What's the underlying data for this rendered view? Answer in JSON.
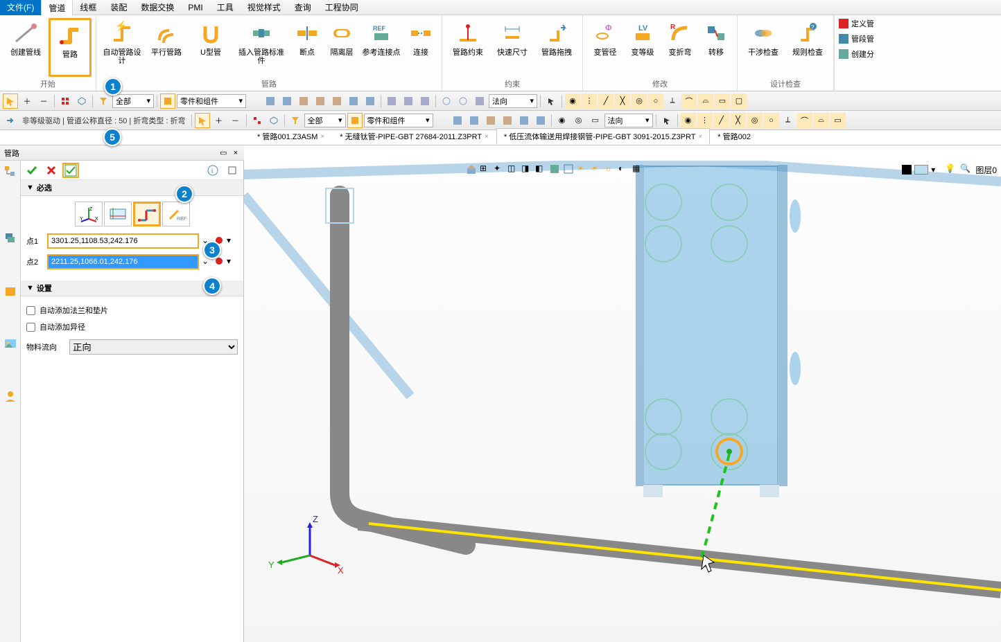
{
  "menu": {
    "file": "文件(F)",
    "items": [
      "管道",
      "线框",
      "装配",
      "数据交换",
      "PMI",
      "工具",
      "视觉样式",
      "查询",
      "工程协同"
    ]
  },
  "ribbon": {
    "groups": {
      "start": {
        "title": "开始",
        "buttons": [
          {
            "id": "create-line",
            "label": "创建管线"
          },
          {
            "id": "route",
            "label": "管路"
          }
        ]
      },
      "route": {
        "title": "管路",
        "buttons": [
          {
            "id": "auto-route",
            "label": "自动管路设计"
          },
          {
            "id": "parallel-route",
            "label": "平行管路"
          },
          {
            "id": "u-pipe",
            "label": "U型管"
          },
          {
            "id": "insert-std",
            "label": "插入管路标准件"
          },
          {
            "id": "breakpoint",
            "label": "断点"
          },
          {
            "id": "isolation",
            "label": "隔离层"
          },
          {
            "id": "ref-connect",
            "label": "参考连接点"
          },
          {
            "id": "connect",
            "label": "连接"
          }
        ]
      },
      "constraint": {
        "title": "约束",
        "buttons": [
          {
            "id": "route-constraint",
            "label": "管路约束"
          },
          {
            "id": "quick-dim",
            "label": "快速尺寸"
          },
          {
            "id": "route-drag",
            "label": "管路拖拽"
          }
        ]
      },
      "modify": {
        "title": "修改",
        "buttons": [
          {
            "id": "change-dia",
            "label": "变管径"
          },
          {
            "id": "change-grade",
            "label": "变等级"
          },
          {
            "id": "change-bend",
            "label": "变折弯"
          },
          {
            "id": "transfer",
            "label": "转移"
          }
        ]
      },
      "design_check": {
        "title": "设计检查",
        "buttons": [
          {
            "id": "interference",
            "label": "干涉检查"
          },
          {
            "id": "rule-check",
            "label": "规则检查"
          }
        ]
      }
    },
    "side_items": [
      "定义管",
      "管段管",
      "创建分"
    ]
  },
  "filterbar1": {
    "combo1": "全部",
    "combo2": "零件和组件",
    "normal": "法向"
  },
  "filterbar2": {
    "status": "非等级驱动 | 管道公称直径 : 50 | 折弯类型 : 折弯",
    "combo1": "全部",
    "combo2": "零件和组件",
    "normal": "法向"
  },
  "tabs": [
    {
      "label": "* 管路001.Z3ASM",
      "active": false
    },
    {
      "label": "* 无缝钛管-PIPE-GBT 27684-2011.Z3PRT",
      "active": false
    },
    {
      "label": "* 低压流体输送用焊接钢管-PIPE-GBT 3091-2015.Z3PRT",
      "active": true
    },
    {
      "label": "* 管路002",
      "active": false
    }
  ],
  "panel": {
    "title": "管路",
    "required_header": "必选",
    "settings_header": "设置",
    "point1_label": "点1",
    "point1_value": "3301.25,1108.53,242.176",
    "point2_label": "点2",
    "point2_value": "2211.25,1066.01,242.176",
    "check_flange": "自动添加法兰和垫片",
    "check_reducer": "自动添加异径",
    "flow_dir_label": "物料流向",
    "flow_dir_value": "正向"
  },
  "viewport": {
    "layer_label": "图层0",
    "axes": {
      "x": "X",
      "y": "Y",
      "z": "Z"
    }
  },
  "steps": {
    "1": "1",
    "2": "2",
    "3": "3",
    "4": "4",
    "5": "5"
  },
  "colors": {
    "accent": "#0b82cb",
    "highlight": "#f5a623"
  }
}
